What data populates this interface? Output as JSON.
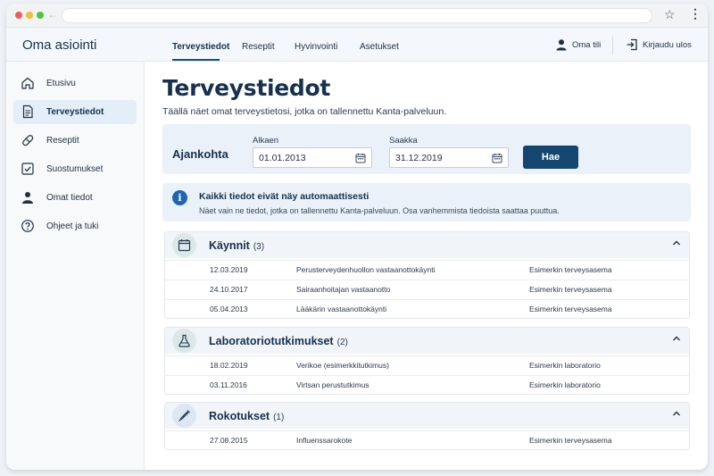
{
  "browser": {
    "star_icon": "star-icon",
    "menu_icon": "kebab-menu-icon"
  },
  "header": {
    "app_title": "Oma asiointi",
    "tabs": [
      {
        "label": "Terveystiedot",
        "active": true
      },
      {
        "label": "Reseptit",
        "active": false
      },
      {
        "label": "Hyvinvointi",
        "active": false
      },
      {
        "label": "Asetukset",
        "active": false
      }
    ],
    "account_label": "Oma tili",
    "logout_label": "Kirjaudu ulos"
  },
  "sidebar": {
    "items": [
      {
        "label": "Etusivu",
        "icon": "home-icon",
        "active": false
      },
      {
        "label": "Terveystiedot",
        "icon": "document-icon",
        "active": true
      },
      {
        "label": "Reseptit",
        "icon": "pill-icon",
        "active": false
      },
      {
        "label": "Suostumukset",
        "icon": "checkbox-icon",
        "active": false
      },
      {
        "label": "Omat tiedot",
        "icon": "user-icon",
        "active": false
      },
      {
        "label": "Ohjeet ja tuki",
        "icon": "help-icon",
        "active": false
      }
    ]
  },
  "main": {
    "title": "Terveystiedot",
    "subtitle": "Täällä näet omat terveystietosi, jotka on tallennettu Kanta-palveluun.",
    "filter": {
      "heading": "Ajankohta",
      "from_label": "Alkaen",
      "from_value": "01.01.2013",
      "to_label": "Saakka",
      "to_value": "31.12.2019",
      "button_label": "Hae"
    },
    "notice": {
      "icon": "info-icon",
      "title": "Kaikki tiedot eivät näy automaattisesti",
      "text": "Näet vain ne tiedot, jotka on tallennettu Kanta-palveluun. Osa vanhemmista tiedoista saattaa puuttua."
    },
    "sections": [
      {
        "title": "Käynnit",
        "count": "(3)",
        "icon": "calendar-icon",
        "rows": [
          {
            "date": "12.03.2019",
            "type": "Perusterveydenhuollon vastaanottokäynti",
            "place": "Esimerkin terveysasema"
          },
          {
            "date": "24.10.2017",
            "type": "Sairaanhoitajan vastaanotto",
            "place": "Esimerkin terveysasema"
          },
          {
            "date": "05.04.2013",
            "type": "Lääkärin vastaanottokäynti",
            "place": "Esimerkin terveysasema"
          }
        ]
      },
      {
        "title": "Laboratoriotutkimukset",
        "count": "(2)",
        "icon": "flask-icon",
        "rows": [
          {
            "date": "18.02.2019",
            "type": "Verikoe (esimerkkitutkimus)",
            "place": "Esimerkin laboratorio"
          },
          {
            "date": "03.11.2016",
            "type": "Virtsan perustutkimus",
            "place": "Esimerkin laboratorio"
          }
        ]
      },
      {
        "title": "Rokotukset",
        "count": "(1)",
        "icon": "syringe-icon",
        "rows": [
          {
            "date": "27.08.2015",
            "type": "Influenssarokote",
            "place": "Esimerkin terveysasema"
          }
        ]
      }
    ]
  }
}
